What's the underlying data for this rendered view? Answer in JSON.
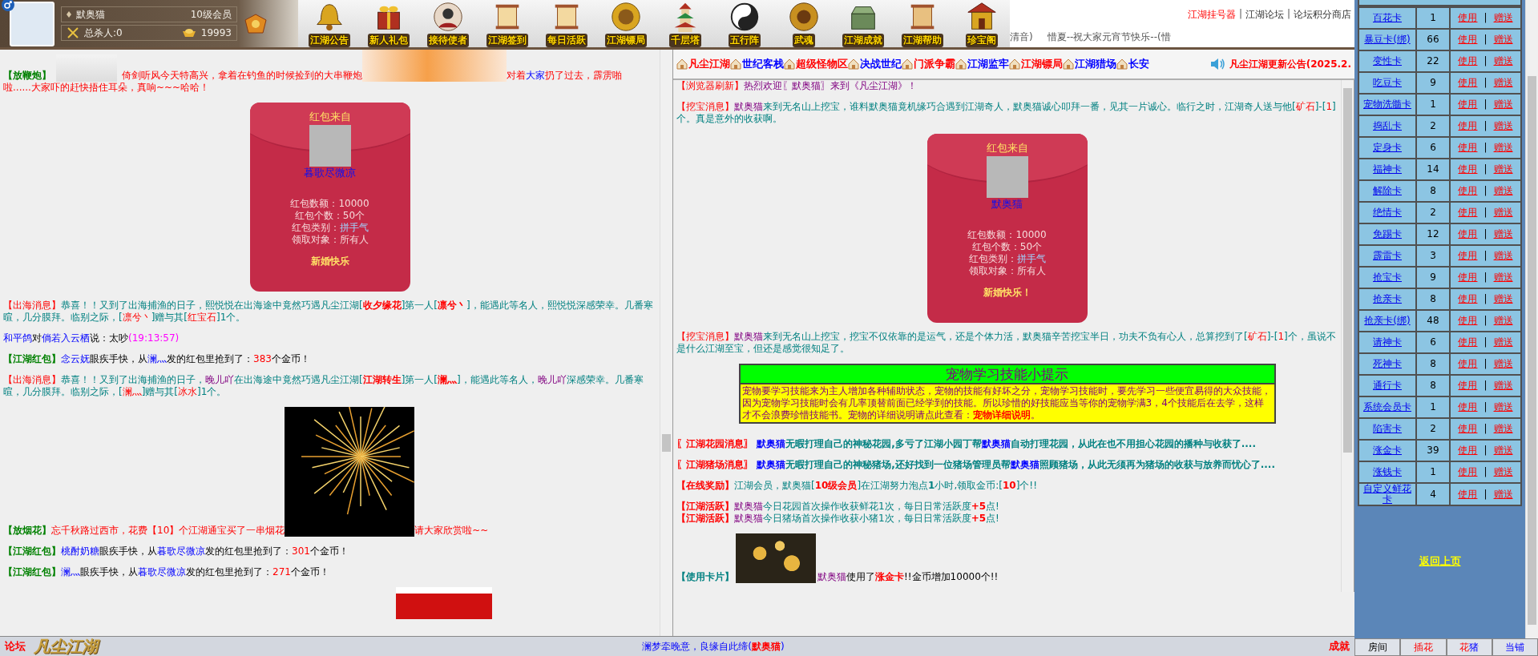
{
  "profile": {
    "name": "默奥猫",
    "level": "10级会员",
    "kills": "总杀人:0",
    "gold": "19993"
  },
  "nav": [
    {
      "label": "江湖公告"
    },
    {
      "label": "新人礼包"
    },
    {
      "label": "接待使者"
    },
    {
      "label": "江湖签到"
    },
    {
      "label": "每日活跃"
    },
    {
      "label": "江湖镖局"
    },
    {
      "label": "千层塔"
    },
    {
      "label": "五行阵"
    },
    {
      "label": "武魂"
    },
    {
      "label": "江湖成就"
    },
    {
      "label": "江湖帮助"
    },
    {
      "label": "珍宝阁"
    }
  ],
  "header_links": [
    {
      "kind": "hot",
      "label": "江湖挂号器"
    },
    {
      "kind": "divider",
      "label": "|"
    },
    {
      "kind": "link",
      "label": "江湖论坛"
    },
    {
      "kind": "divider",
      "label": "|"
    },
    {
      "kind": "link",
      "label": "论坛积分商店"
    }
  ],
  "header_marquee": [
    "清音)",
    "惜夏--祝大家元宵节快乐--(惜"
  ],
  "left_chat": {
    "items": [
      {
        "kind": "message",
        "parts": [
          {
            "kind": "text",
            "segments": [
              {
                "kind": "tag",
                "text": "【放鞭炮】"
              }
            ]
          },
          {
            "kind": "sprite"
          },
          {
            "kind": "text",
            "segments": [
              {
                "kind": "red",
                "text": "倚剑听风今天特高兴，拿着在钓鱼的时候捡到的大串鞭炮"
              }
            ]
          },
          {
            "kind": "blast"
          },
          {
            "kind": "text",
            "segments": [
              {
                "kind": "red",
                "text": "对着"
              },
              {
                "kind": "name",
                "text": "大家"
              },
              {
                "kind": "red",
                "text": "扔了过去，霹雳啪"
              }
            ]
          },
          {
            "kind": "break"
          },
          {
            "kind": "text",
            "segments": [
              {
                "kind": "red",
                "text": "啦......大家吓的赶快捂住耳朵，真响~~~哈哈！"
              }
            ]
          }
        ]
      },
      {
        "kind": "envelope",
        "title": "红包来自",
        "sender": "暮歌尽微凉",
        "details": [
          {
            "label": "红包数额：",
            "value": "10000",
            "kind": "plain"
          },
          {
            "label": "红包个数：",
            "value": "50个",
            "kind": "plain"
          },
          {
            "label": "红包类别：",
            "value": "拼手气",
            "kind": "accent"
          },
          {
            "label": "领取对象：",
            "value": "所有人",
            "kind": "plain"
          }
        ],
        "greeting": "新婚快乐"
      },
      {
        "kind": "message",
        "parts": [
          {
            "kind": "text",
            "segments": [
              {
                "kind": "alert",
                "text": "【出海消息】"
              },
              {
                "kind": "teal",
                "text": "恭喜！！又到了出海捕渔的日子，熙悦悦在出海途中竟然巧遇凡尘江湖["
              },
              {
                "kind": "strong",
                "text": "收夕缘花"
              },
              {
                "kind": "teal",
                "text": "]第一人["
              },
              {
                "kind": "strong",
                "text": "凛兮丶"
              },
              {
                "kind": "teal",
                "text": "]，能遇此等名人，熙悦悦深感荣幸。几番寒暄，几分膜拜。临别之际，["
              },
              {
                "kind": "red",
                "text": "凛兮丶"
              },
              {
                "kind": "teal",
                "text": "]赠与其["
              },
              {
                "kind": "red",
                "text": "红宝石"
              },
              {
                "kind": "teal",
                "text": "]1个。"
              }
            ]
          }
        ]
      },
      {
        "kind": "message",
        "parts": [
          {
            "kind": "text",
            "segments": [
              {
                "kind": "name",
                "text": "和平鸽"
              },
              {
                "kind": "plain",
                "text": "对"
              },
              {
                "kind": "name",
                "text": "倘若入云栖"
              },
              {
                "kind": "plain",
                "text": "说：太吵"
              },
              {
                "kind": "time",
                "text": "(19:13:57)"
              }
            ]
          }
        ]
      },
      {
        "kind": "message",
        "parts": [
          {
            "kind": "text",
            "segments": [
              {
                "kind": "tag",
                "text": "【江湖红包】"
              },
              {
                "kind": "name",
                "text": "念云妩"
              },
              {
                "kind": "plain",
                "text": "眼疾手快，从"
              },
              {
                "kind": "name",
                "text": "澜灬"
              },
              {
                "kind": "plain",
                "text": "发的红包里抢到了："
              },
              {
                "kind": "red",
                "text": "383"
              },
              {
                "kind": "plain",
                "text": "个金币！"
              }
            ]
          }
        ]
      },
      {
        "kind": "message",
        "parts": [
          {
            "kind": "text",
            "segments": [
              {
                "kind": "alert",
                "text": "【出海消息】"
              },
              {
                "kind": "teal",
                "text": "恭喜！！又到了出海捕渔的日子，"
              },
              {
                "kind": "violet",
                "text": "晚儿吖"
              },
              {
                "kind": "teal",
                "text": "在出海途中竟然巧遇凡尘江湖["
              },
              {
                "kind": "strong",
                "text": "江湖转生"
              },
              {
                "kind": "teal",
                "text": "]第一人["
              },
              {
                "kind": "strong",
                "text": "澜灬"
              },
              {
                "kind": "teal",
                "text": "]，能遇此等名人，"
              },
              {
                "kind": "violet",
                "text": "晚儿吖"
              },
              {
                "kind": "teal",
                "text": "深感荣幸。几番寒暄，几分膜拜。临别之际，["
              },
              {
                "kind": "red",
                "text": "澜灬"
              },
              {
                "kind": "teal",
                "text": "]赠与其["
              },
              {
                "kind": "red",
                "text": "冰水"
              },
              {
                "kind": "teal",
                "text": "]1个。"
              }
            ]
          }
        ]
      },
      {
        "kind": "message",
        "parts": [
          {
            "kind": "text",
            "segments": [
              {
                "kind": "tag",
                "text": "【放烟花】"
              },
              {
                "kind": "red",
                "text": "忘千秋路过西市，花费【10】个江湖通宝买了一串烟花"
              }
            ]
          },
          {
            "kind": "fireworks"
          },
          {
            "kind": "text",
            "segments": [
              {
                "kind": "red",
                "text": "请大家欣赏啦~~"
              }
            ]
          }
        ]
      },
      {
        "kind": "message",
        "parts": [
          {
            "kind": "text",
            "segments": [
              {
                "kind": "tag",
                "text": "【江湖红包】"
              },
              {
                "kind": "name",
                "text": "桃酎奶糖"
              },
              {
                "kind": "plain",
                "text": "眼疾手快，从"
              },
              {
                "kind": "name",
                "text": "暮歌尽微凉"
              },
              {
                "kind": "plain",
                "text": "发的红包里抢到了："
              },
              {
                "kind": "red",
                "text": "301"
              },
              {
                "kind": "plain",
                "text": "个金币！"
              }
            ]
          }
        ]
      },
      {
        "kind": "message",
        "parts": [
          {
            "kind": "text",
            "segments": [
              {
                "kind": "tag",
                "text": "【江湖红包】"
              },
              {
                "kind": "name",
                "text": "澜灬"
              },
              {
                "kind": "plain",
                "text": "眼疾手快，从"
              },
              {
                "kind": "name",
                "text": "暮歌尽微凉"
              },
              {
                "kind": "plain",
                "text": "发的红包里抢到了："
              },
              {
                "kind": "red",
                "text": "271"
              },
              {
                "kind": "plain",
                "text": "个金币！"
              }
            ]
          }
        ]
      },
      {
        "kind": "picture"
      }
    ]
  },
  "right_chat": {
    "nav": [
      {
        "label": "凡尘江湖",
        "color": "#ff0000"
      },
      {
        "label": "世纪客栈",
        "color": "#0000ff"
      },
      {
        "label": "超级怪物区",
        "color": "#ff0000"
      },
      {
        "label": "决战世纪",
        "color": "#0000ff"
      },
      {
        "label": "门派争霸",
        "color": "#ff0000"
      },
      {
        "label": "江湖监牢",
        "color": "#0000ff"
      },
      {
        "label": "江湖镖局",
        "color": "#ff0000"
      },
      {
        "label": "江湖猎场",
        "color": "#0000ff"
      },
      {
        "label": "长安",
        "color": "#0000ff"
      }
    ],
    "notice": "凡尘江湖更新公告(2025.2.",
    "items": [
      {
        "kind": "message",
        "parts": [
          {
            "kind": "text",
            "segments": [
              {
                "kind": "alert",
                "text": "【浏览器刷新】"
              },
              {
                "kind": "violet",
                "text": "热烈欢迎〖默奥猫〗来到《凡尘江湖》！"
              }
            ]
          }
        ]
      },
      {
        "kind": "message",
        "parts": [
          {
            "kind": "text",
            "segments": [
              {
                "kind": "alert",
                "text": "【挖宝消息】"
              },
              {
                "kind": "violet",
                "text": "默奥猫"
              },
              {
                "kind": "teal",
                "text": "来到无名山上挖宝，谁料默奥猫竟机缘巧合遇到江湖奇人，默奥猫诚心叩拜一番，见其一片诚心。临行之时，江湖奇人送与他["
              },
              {
                "kind": "red",
                "text": "矿石"
              },
              {
                "kind": "teal",
                "text": "]-["
              },
              {
                "kind": "red",
                "text": "1"
              },
              {
                "kind": "teal",
                "text": "]个。真是意外的收获啊。"
              }
            ]
          }
        ]
      },
      {
        "kind": "envelope",
        "title": "红包来自",
        "sender": "默奥猫",
        "details": [
          {
            "label": "红包数额：",
            "value": "10000",
            "kind": "plain"
          },
          {
            "label": "红包个数：",
            "value": "50个",
            "kind": "plain"
          },
          {
            "label": "红包类别：",
            "value": "拼手气",
            "kind": "accent"
          },
          {
            "label": "领取对象：",
            "value": "所有人",
            "kind": "plain"
          }
        ],
        "greeting": "新婚快乐！"
      },
      {
        "kind": "message",
        "parts": [
          {
            "kind": "text",
            "segments": [
              {
                "kind": "alert",
                "text": "【挖宝消息】"
              },
              {
                "kind": "violet",
                "text": "默奥猫"
              },
              {
                "kind": "teal",
                "text": "来到无名山上挖宝，挖宝不仅依靠的是运气，还是个体力活，默奥猫辛苦挖宝半日，功夫不负有心人，总算挖到了["
              },
              {
                "kind": "red",
                "text": "矿石"
              },
              {
                "kind": "teal",
                "text": "]-["
              },
              {
                "kind": "red",
                "text": "1"
              },
              {
                "kind": "teal",
                "text": "]个，虽说不是什么江湖至宝，但还是感觉很知足了。"
              }
            ]
          }
        ]
      },
      {
        "kind": "tip",
        "title": "宠物学习技能小提示",
        "body": "宠物要学习技能来为主人增加各种辅助状态，宠物的技能有好坏之分，宠物学习技能时，要先学习一些便宜易得的大众技能，因为宠物学习技能时会有几率顶替前面已经学到的技能。所以珍惜的好技能应当等你的宠物学满3，4个技能后在去学，这样才不会浪费珍惜技能书。宠物的详细说明请点此查看：",
        "link": "宠物详细说明",
        "end": "。"
      },
      {
        "kind": "message",
        "parts": [
          {
            "kind": "text",
            "segments": [
              {
                "kind": "strong",
                "text": "〖江湖花园消息〗 "
              },
              {
                "kind": "boldname",
                "text": "默奥猫"
              },
              {
                "kind": "boldteal",
                "text": "无暇打理自己的神秘花园,多亏了江湖小园丁帮"
              },
              {
                "kind": "boldname",
                "text": "默奥猫"
              },
              {
                "kind": "boldteal",
                "text": "自动打理花园，从此在也不用担心花园的播种与收获了...."
              }
            ]
          }
        ]
      },
      {
        "kind": "message",
        "parts": [
          {
            "kind": "text",
            "segments": [
              {
                "kind": "strong",
                "text": "〖江湖猪场消息〗 "
              },
              {
                "kind": "boldname",
                "text": "默奥猫"
              },
              {
                "kind": "boldteal",
                "text": "无暇打理自己的神秘猪场,还好找到一位猪场管理员帮"
              },
              {
                "kind": "boldname",
                "text": "默奥猫"
              },
              {
                "kind": "boldteal",
                "text": "照顾猪场，从此无须再为猪场的收获与放养而忧心了...."
              }
            ]
          }
        ]
      },
      {
        "kind": "message",
        "parts": [
          {
            "kind": "text",
            "segments": [
              {
                "kind": "strong",
                "text": "【在线奖励】"
              },
              {
                "kind": "teal",
                "text": "江湖会员，默奥猫["
              },
              {
                "kind": "strong",
                "text": "10级会员"
              },
              {
                "kind": "teal",
                "text": "]在江湖努力泡点"
              },
              {
                "kind": "boldteal",
                "text": "1"
              },
              {
                "kind": "teal",
                "text": "小时,领取金币:["
              },
              {
                "kind": "strong",
                "text": "10"
              },
              {
                "kind": "teal",
                "text": "]个!!"
              }
            ]
          }
        ]
      },
      {
        "kind": "message",
        "parts": [
          {
            "kind": "text",
            "segments": [
              {
                "kind": "strong",
                "text": "【江湖活跃】"
              },
              {
                "kind": "violet",
                "text": "默奥猫"
              },
              {
                "kind": "teal",
                "text": "今日花园首次操作收获鲜花1次，每日日常活跃度"
              },
              {
                "kind": "strong",
                "text": "+5"
              },
              {
                "kind": "teal",
                "text": "点!"
              }
            ]
          },
          {
            "kind": "break"
          },
          {
            "kind": "text",
            "segments": [
              {
                "kind": "strong",
                "text": "【江湖活跃】"
              },
              {
                "kind": "violet",
                "text": "默奥猫"
              },
              {
                "kind": "teal",
                "text": "今日猪场首次操作收获小猪1次，每日日常活跃度"
              },
              {
                "kind": "strong",
                "text": "+5"
              },
              {
                "kind": "teal",
                "text": "点!"
              }
            ]
          }
        ]
      },
      {
        "kind": "message",
        "parts": [
          {
            "kind": "text",
            "segments": [
              {
                "kind": "boldteal",
                "text": "【使用卡片】"
              }
            ]
          },
          {
            "kind": "card"
          },
          {
            "kind": "text",
            "segments": [
              {
                "kind": "violet",
                "text": "默奥猫"
              },
              {
                "kind": "plain",
                "text": "使用了"
              },
              {
                "kind": "strong",
                "text": "涨金卡"
              },
              {
                "kind": "plain",
                "text": "!!金币增加10000个!!"
              }
            ]
          }
        ]
      }
    ]
  },
  "bottom_bar": {
    "forum": "论坛",
    "logo": "凡尘江湖",
    "marquee": [
      {
        "kind": "name",
        "text": "澜梦牵晚意，良缘自此缔("
      },
      {
        "kind": "strong",
        "text": "默奥猫"
      },
      {
        "kind": "name",
        "text": ")"
      }
    ],
    "achievement": "成就"
  },
  "sidebar": {
    "cards": [
      {
        "name": "百花卡",
        "count": "1",
        "actions": [
          {
            "kind": "link",
            "label": "使用"
          },
          {
            "kind": "divider",
            "label": "|"
          },
          {
            "kind": "link",
            "label": "赠送"
          }
        ]
      },
      {
        "name": "暴豆卡(绑)",
        "count": "66",
        "actions": [
          {
            "kind": "link",
            "label": "使用"
          },
          {
            "kind": "divider",
            "label": "|"
          },
          {
            "kind": "link",
            "label": "赠送"
          }
        ]
      },
      {
        "name": "变性卡",
        "count": "22",
        "actions": [
          {
            "kind": "link",
            "label": "使用"
          },
          {
            "kind": "divider",
            "label": "|"
          },
          {
            "kind": "link",
            "label": "赠送"
          }
        ]
      },
      {
        "name": "吃豆卡",
        "count": "9",
        "actions": [
          {
            "kind": "link",
            "label": "使用"
          },
          {
            "kind": "divider",
            "label": "|"
          },
          {
            "kind": "link",
            "label": "赠送"
          }
        ]
      },
      {
        "name": "宠物洗髓卡",
        "count": "1",
        "actions": [
          {
            "kind": "link",
            "label": "使用"
          },
          {
            "kind": "divider",
            "label": "|"
          },
          {
            "kind": "link",
            "label": "赠送"
          }
        ]
      },
      {
        "name": "捣乱卡",
        "count": "2",
        "actions": [
          {
            "kind": "link",
            "label": "使用"
          },
          {
            "kind": "divider",
            "label": "|"
          },
          {
            "kind": "link",
            "label": "赠送"
          }
        ]
      },
      {
        "name": "定身卡",
        "count": "6",
        "actions": [
          {
            "kind": "link",
            "label": "使用"
          },
          {
            "kind": "divider",
            "label": "|"
          },
          {
            "kind": "link",
            "label": "赠送"
          }
        ]
      },
      {
        "name": "福神卡",
        "count": "14",
        "actions": [
          {
            "kind": "link",
            "label": "使用"
          },
          {
            "kind": "divider",
            "label": "|"
          },
          {
            "kind": "link",
            "label": "赠送"
          }
        ]
      },
      {
        "name": "解除卡",
        "count": "8",
        "actions": [
          {
            "kind": "link",
            "label": "使用"
          },
          {
            "kind": "divider",
            "label": "|"
          },
          {
            "kind": "link",
            "label": "赠送"
          }
        ]
      },
      {
        "name": "绝情卡",
        "count": "2",
        "actions": [
          {
            "kind": "link",
            "label": "使用"
          },
          {
            "kind": "divider",
            "label": "|"
          },
          {
            "kind": "link",
            "label": "赠送"
          }
        ]
      },
      {
        "name": "免踢卡",
        "count": "12",
        "actions": [
          {
            "kind": "link",
            "label": "使用"
          },
          {
            "kind": "divider",
            "label": "|"
          },
          {
            "kind": "link",
            "label": "赠送"
          }
        ]
      },
      {
        "name": "霹雷卡",
        "count": "3",
        "actions": [
          {
            "kind": "link",
            "label": "使用"
          },
          {
            "kind": "divider",
            "label": "|"
          },
          {
            "kind": "link",
            "label": "赠送"
          }
        ]
      },
      {
        "name": "抢宝卡",
        "count": "9",
        "actions": [
          {
            "kind": "link",
            "label": "使用"
          },
          {
            "kind": "divider",
            "label": "|"
          },
          {
            "kind": "link",
            "label": "赠送"
          }
        ]
      },
      {
        "name": "抢亲卡",
        "count": "8",
        "actions": [
          {
            "kind": "link",
            "label": "使用"
          },
          {
            "kind": "divider",
            "label": "|"
          },
          {
            "kind": "link",
            "label": "赠送"
          }
        ]
      },
      {
        "name": "抢亲卡(绑)",
        "count": "48",
        "actions": [
          {
            "kind": "link",
            "label": "使用"
          },
          {
            "kind": "divider",
            "label": "|"
          },
          {
            "kind": "link",
            "label": "赠送"
          }
        ]
      },
      {
        "name": "请神卡",
        "count": "6",
        "actions": [
          {
            "kind": "link",
            "label": "使用"
          },
          {
            "kind": "divider",
            "label": "|"
          },
          {
            "kind": "link",
            "label": "赠送"
          }
        ]
      },
      {
        "name": "死神卡",
        "count": "8",
        "actions": [
          {
            "kind": "link",
            "label": "使用"
          },
          {
            "kind": "divider",
            "label": "|"
          },
          {
            "kind": "link",
            "label": "赠送"
          }
        ]
      },
      {
        "name": "通行卡",
        "count": "8",
        "actions": [
          {
            "kind": "link",
            "label": "使用"
          },
          {
            "kind": "divider",
            "label": "|"
          },
          {
            "kind": "link",
            "label": "赠送"
          }
        ]
      },
      {
        "name": "系统会员卡",
        "count": "1",
        "actions": [
          {
            "kind": "link",
            "label": "使用"
          },
          {
            "kind": "divider",
            "label": "|"
          },
          {
            "kind": "link",
            "label": "赠送"
          }
        ]
      },
      {
        "name": "陷害卡",
        "count": "2",
        "actions": [
          {
            "kind": "link",
            "label": "使用"
          },
          {
            "kind": "divider",
            "label": "|"
          },
          {
            "kind": "link",
            "label": "赠送"
          }
        ]
      },
      {
        "name": "涨金卡",
        "count": "39",
        "actions": [
          {
            "kind": "link",
            "label": "使用"
          },
          {
            "kind": "divider",
            "label": "|"
          },
          {
            "kind": "link",
            "label": "赠送"
          }
        ]
      },
      {
        "name": "涨钱卡",
        "count": "1",
        "actions": [
          {
            "kind": "link",
            "label": "使用"
          },
          {
            "kind": "divider",
            "label": "|"
          },
          {
            "kind": "link",
            "label": "赠送"
          }
        ]
      },
      {
        "name": "自定义鲜花卡",
        "count": "4",
        "actions": [
          {
            "kind": "link",
            "label": "使用"
          },
          {
            "kind": "divider",
            "label": "|"
          },
          {
            "kind": "link",
            "label": "赠送"
          }
        ]
      }
    ],
    "back": "返回上页",
    "tabs": [
      {
        "segments": [
          {
            "kind": "plain",
            "text": "房间"
          }
        ]
      },
      {
        "segments": [
          {
            "kind": "red",
            "text": "插花"
          }
        ]
      },
      {
        "segments": [
          {
            "kind": "red",
            "text": "花"
          },
          {
            "kind": "name",
            "text": "猪"
          }
        ]
      },
      {
        "segments": [
          {
            "kind": "name",
            "text": "当铺"
          }
        ]
      }
    ]
  }
}
